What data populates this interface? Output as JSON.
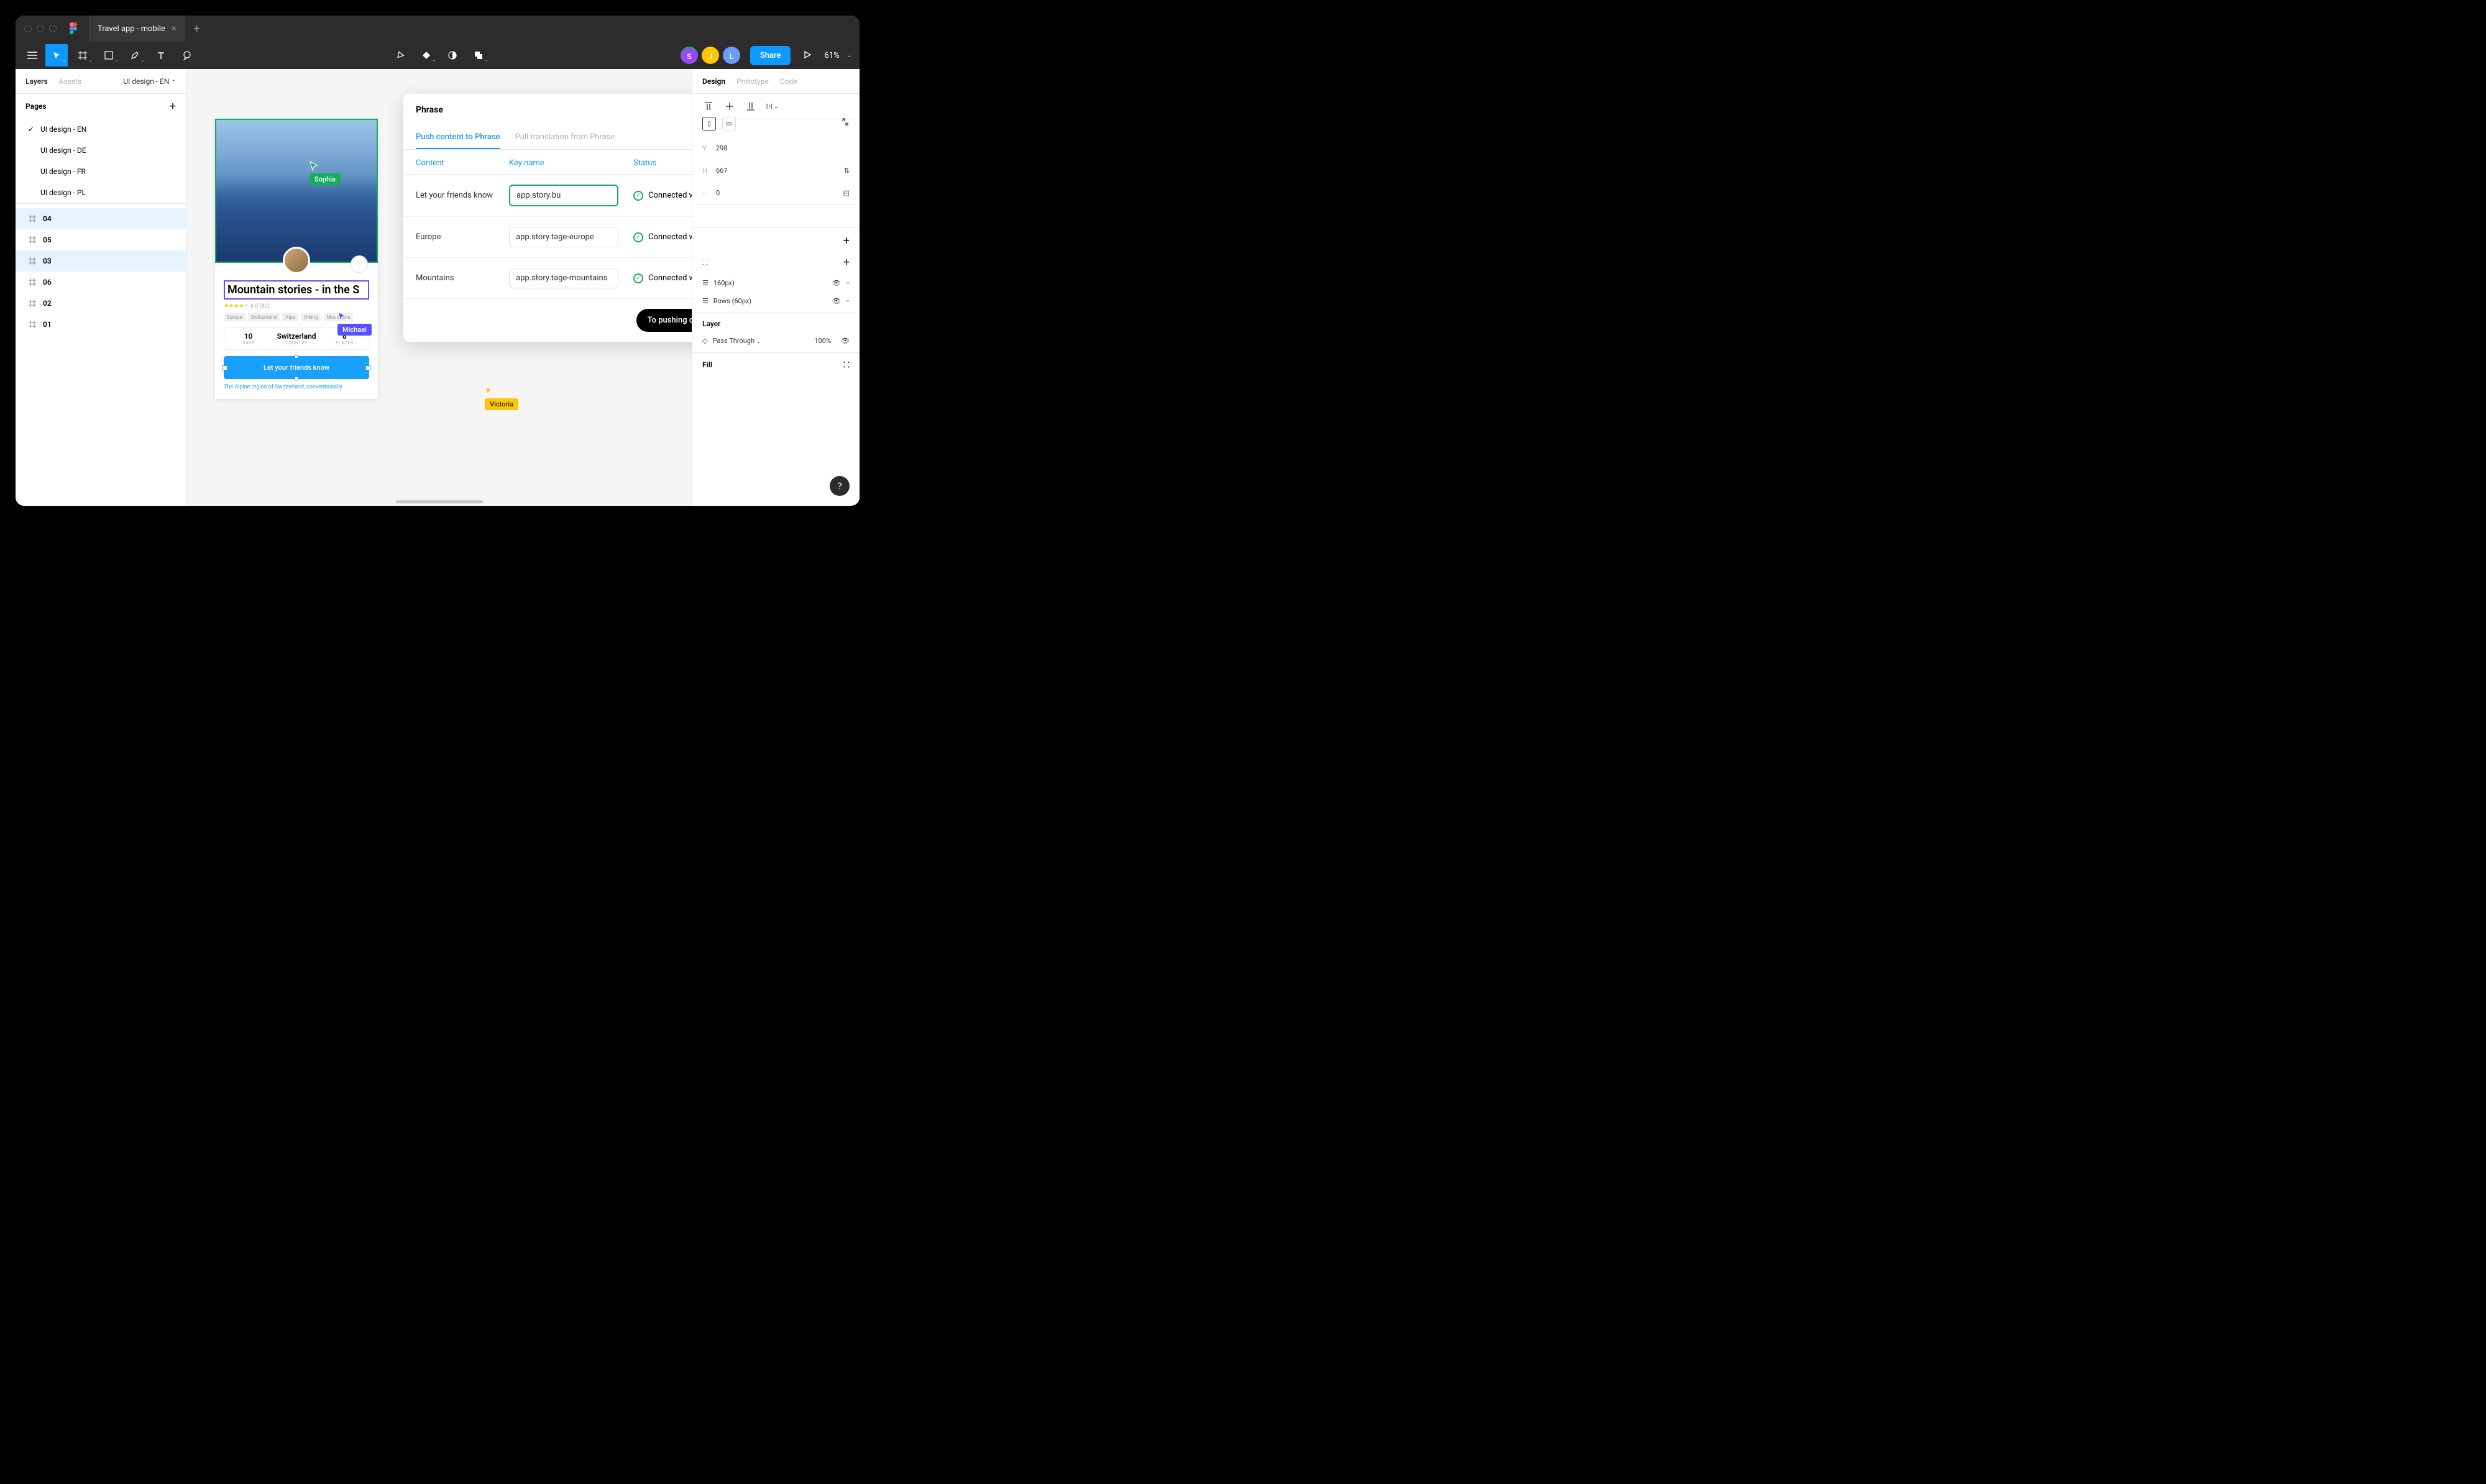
{
  "titlebar": {
    "tab": "Travel app - mobile"
  },
  "toolbar": {
    "share": "Share",
    "zoom": "61%"
  },
  "avatars": {
    "s": "S",
    "j": "J",
    "l": "L"
  },
  "left": {
    "tabs": {
      "layers": "Layers",
      "assets": "Assets",
      "page": "UI design - EN"
    },
    "pages_header": "Pages",
    "pages": [
      {
        "label": "UI design - EN",
        "selected": true
      },
      {
        "label": "UI design - DE"
      },
      {
        "label": "UI design - FR"
      },
      {
        "label": "UI design - PL"
      }
    ],
    "frames": [
      {
        "label": "04",
        "hl": true
      },
      {
        "label": "05"
      },
      {
        "label": "03",
        "hl": true
      },
      {
        "label": "06"
      },
      {
        "label": "02"
      },
      {
        "label": "01"
      }
    ]
  },
  "artboard": {
    "title": "Mountain stories - in the S",
    "rating": "4.0 (82)",
    "tags": [
      "Europe",
      "Switzerland",
      "Alps",
      "Hiking",
      "Mountains"
    ],
    "stats": [
      {
        "num": "10",
        "cap": "DAYS"
      },
      {
        "num": "Switzerland",
        "cap": "COUNTRY"
      },
      {
        "num": "8",
        "cap": "PLACES"
      }
    ],
    "button": "Let your friends know",
    "desc": "The Alpine region of Switzerland, conventionally"
  },
  "cursors": {
    "sophia": "Sophia",
    "michael": "Michael",
    "victoria": "Victoria"
  },
  "plugin": {
    "title": "Phrase",
    "tabs": {
      "push": "Push content to Phrase",
      "pull": "Pull translation from Phrase"
    },
    "cols": {
      "content": "Content",
      "key": "Key name",
      "status": "Status"
    },
    "rows": [
      {
        "content": "Let your friends know",
        "key": "app.story.bu",
        "status": "Connected with Phrase",
        "active": true
      },
      {
        "content": "Europe",
        "key": "app.story.tage-europe",
        "status": "Connected with Phrase"
      },
      {
        "content": "Mountains",
        "key": "app.story.tage-mountains",
        "status": "Connected with Phrase"
      }
    ],
    "confirm": "To pushing confirmation"
  },
  "right": {
    "tabs": {
      "design": "Design",
      "prototype": "Prototype",
      "code": "Code"
    },
    "y": "298",
    "h": "667",
    "r": "0",
    "cols_label": "160px)",
    "rows_label": "Rows (60px)",
    "layer": "Layer",
    "blend": "Pass Through",
    "opacity": "100%",
    "fill": "Fill"
  }
}
